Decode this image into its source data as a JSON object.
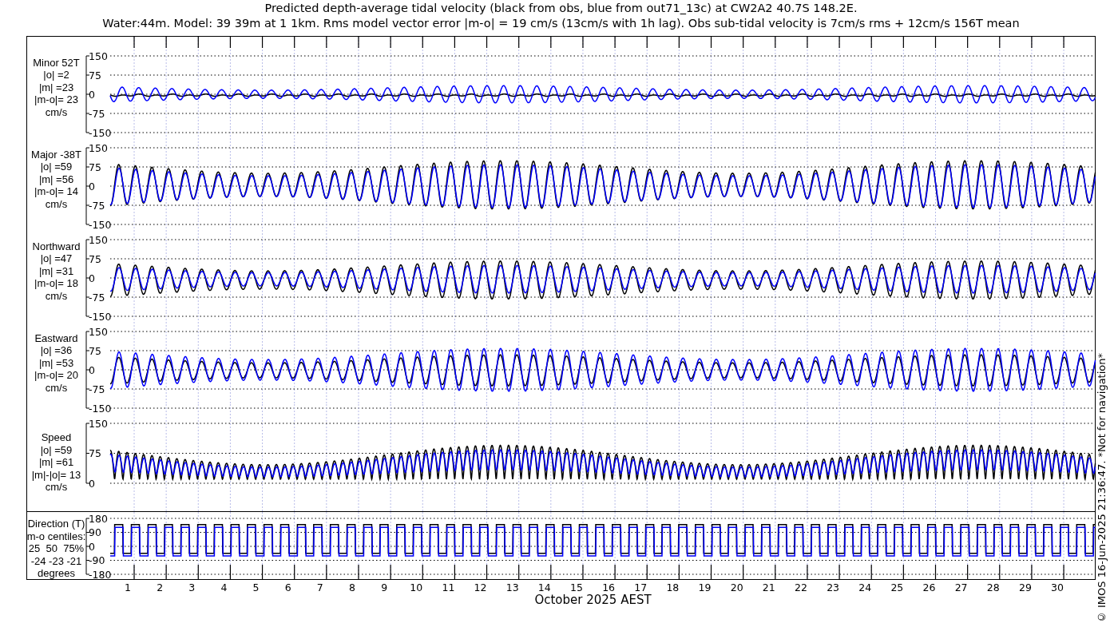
{
  "title_lines": [
    "Predicted depth-average tidal velocity (black from obs, blue from out71_13c) at CW2A2 40.7S 148.2E.",
    "Water:44m. Model: 39 39m at 1 1km. Rms model vector error |m-o| = 19 cm/s (13cm/s with 1h lag). Obs sub-tidal velocity is 7cm/s rms + 12cm/s 156T mean"
  ],
  "panels": [
    {
      "kind": "minor",
      "label_lines": [
        "Minor 52T",
        "|o| =2",
        "|m| =23",
        "|m-o|= 23",
        "cm/s"
      ],
      "yticks": [
        "150",
        "75",
        "0",
        "-75",
        "-150"
      ]
    },
    {
      "kind": "major",
      "label_lines": [
        "Major -38T",
        "|o| =59",
        "|m| =56",
        "|m-o|= 14",
        "cm/s"
      ],
      "yticks": [
        "150",
        "75",
        "0",
        "-75",
        "-150"
      ]
    },
    {
      "kind": "northward",
      "label_lines": [
        "Northward",
        "|o| =47",
        "|m| =31",
        "|m-o|= 18",
        "cm/s"
      ],
      "yticks": [
        "150",
        "75",
        "0",
        "-75",
        "-150"
      ]
    },
    {
      "kind": "eastward",
      "label_lines": [
        "Eastward",
        "|o| =36",
        "|m| =53",
        "|m-o|= 20",
        "cm/s"
      ],
      "yticks": [
        "150",
        "75",
        "0",
        "-75",
        "-150"
      ]
    },
    {
      "kind": "speed",
      "label_lines": [
        "Speed",
        "|o| =59",
        "|m| =61",
        "|m|-|o|= 13",
        "cm/s"
      ],
      "yticks": [
        "150",
        "75",
        "0"
      ]
    },
    {
      "kind": "direction",
      "label_lines": [
        "Direction (T)",
        "m-o centiles:",
        "25  50  75%",
        "-24 -23 -21",
        "degrees"
      ],
      "yticks": [
        "180",
        "90",
        "0",
        "-90",
        "-180"
      ]
    }
  ],
  "day_labels": [
    "1",
    "2",
    "3",
    "4",
    "5",
    "6",
    "7",
    "8",
    "9",
    "10",
    "11",
    "12",
    "13",
    "14",
    "15",
    "16",
    "17",
    "18",
    "19",
    "20",
    "21",
    "22",
    "23",
    "24",
    "25",
    "26",
    "27",
    "28",
    "29",
    "30"
  ],
  "xlabel": "October 2025 AEST",
  "credit": "© IMOS 16-Jun-2025 21:36:47. *Not for navigation*"
}
